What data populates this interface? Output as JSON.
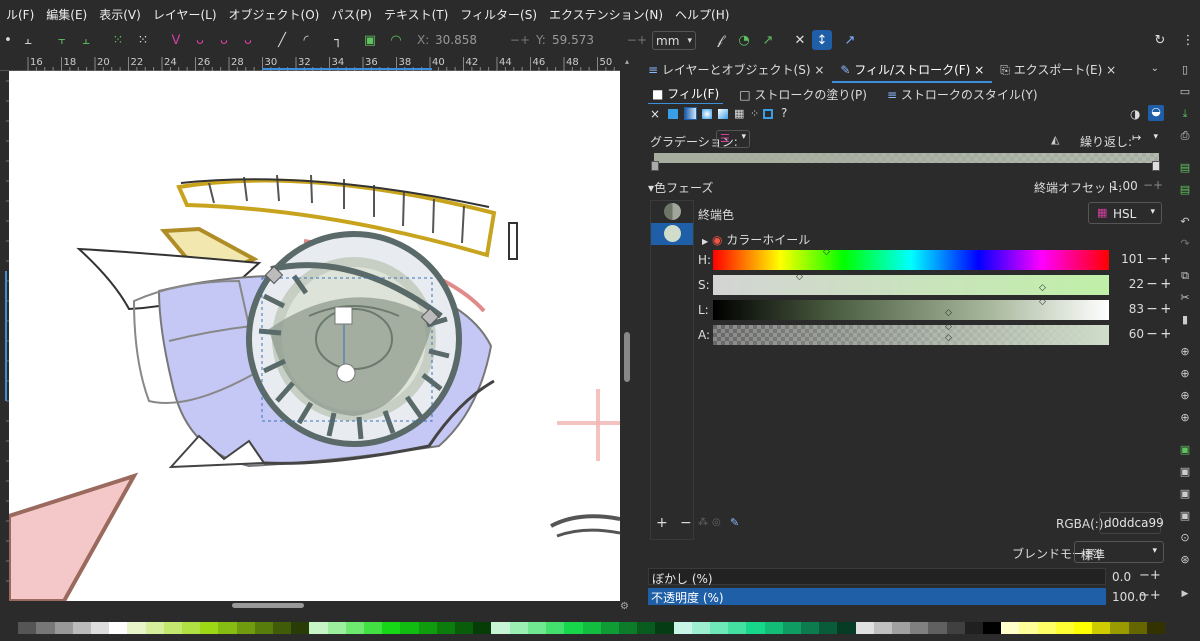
{
  "menubar": {
    "items": [
      "ル(F)",
      "編集(E)",
      "表示(V)",
      "レイヤー(L)",
      "オブジェクト(O)",
      "パス(P)",
      "テキスト(T)",
      "フィルター(S)",
      "エクステンション(N)",
      "ヘルプ(H)"
    ]
  },
  "toolbar": {
    "x_label": "X:",
    "x_value": "30.858",
    "y_label": "Y:",
    "y_value": "59.573",
    "unit": "mm"
  },
  "ruler": {
    "top_ticks": [
      "16",
      "18",
      "20",
      "22",
      "24",
      "26",
      "28",
      "30",
      "32",
      "34",
      "36",
      "38",
      "40",
      "42",
      "44",
      "46",
      "48",
      "50"
    ]
  },
  "panel": {
    "tabs": [
      {
        "label": "レイヤーとオブジェクト(S)",
        "close": "×"
      },
      {
        "label": "フィル/ストローク(F)",
        "close": "×"
      },
      {
        "label": "エクスポート(E)",
        "close": "×"
      }
    ],
    "subtabs": [
      "フィル(F)",
      "ストロークの塗り(P)",
      "ストロークのスタイル(Y)"
    ],
    "gradient_label": "グラデーション:",
    "repeat_label": "繰り返し:",
    "stops_label": "色フェーズ",
    "end_offset_label": "終端オフセット:",
    "end_offset_value": "1.00",
    "end_color_label": "終端色",
    "color_mode": "HSL",
    "color_wheel_label": "カラーホイール",
    "sliders": [
      {
        "label": "H:",
        "value": "101"
      },
      {
        "label": "S:",
        "value": "22"
      },
      {
        "label": "L:",
        "value": "83"
      },
      {
        "label": "A:",
        "value": "60"
      }
    ],
    "rgba_label": "RGBA(:):",
    "rgba_value": "d0ddca99",
    "blend_label": "ブレンドモード:",
    "blend_value": "標準",
    "blur_label": "ぼかし (%)",
    "blur_value": "0.0",
    "opacity_label": "不透明度 (%)",
    "opacity_value": "100.0",
    "help_icon": "?",
    "close_icon": "×"
  },
  "colors": {
    "accent": "#1f5fa8",
    "selected_color": "#d0ddca"
  }
}
